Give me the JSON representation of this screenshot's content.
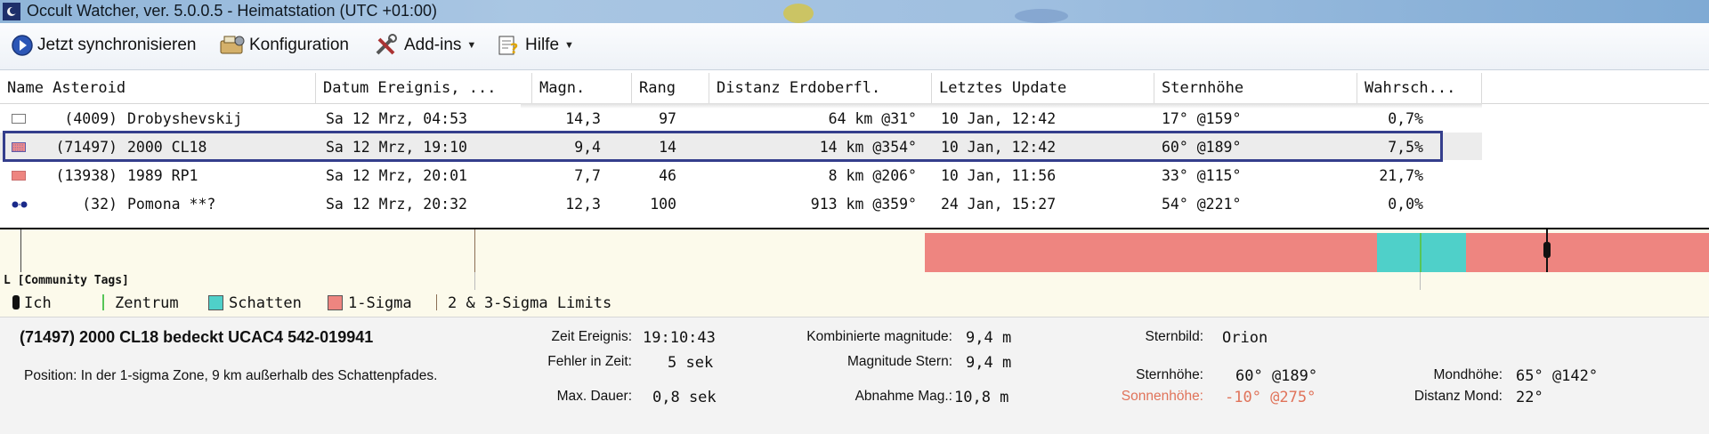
{
  "window": {
    "title": "Occult Watcher, ver. 5.0.0.5 - Heimatstation (UTC +01:00)"
  },
  "toolbar": {
    "sync_label": "Jetzt synchronisieren",
    "config_label": "Konfiguration",
    "addins_label": "Add-ins",
    "help_label": "Hilfe"
  },
  "table": {
    "headers": [
      "Name Asteroid",
      "Datum Ereignis, ...",
      "Magn.",
      "Rang",
      "Distanz Erdoberfl.",
      "Letztes Update",
      "Sternhöhe",
      "Wahrsch..."
    ],
    "rows": [
      {
        "number": "(4009)",
        "name": "Drobyshevskij",
        "date": "Sa 12 Mrz, 04:53",
        "magn": "14,3",
        "rank": "97",
        "distance": "64 km @31°",
        "updated": "10 Jan, 12:42",
        "alt": "17° @159°",
        "prob": "0,7%"
      },
      {
        "number": "(71497)",
        "name": "2000 CL18",
        "date": "Sa 12 Mrz, 19:10",
        "magn": "9,4",
        "rank": "14",
        "distance": "14 km @354°",
        "updated": "10 Jan, 12:42",
        "alt": "60° @189°",
        "prob": "7,5%"
      },
      {
        "number": "(13938)",
        "name": "1989 RP1",
        "date": "Sa 12 Mrz, 20:01",
        "magn": "7,7",
        "rank": "46",
        "distance": "8 km @206°",
        "updated": "10 Jan, 11:56",
        "alt": "33° @115°",
        "prob": "21,7%"
      },
      {
        "number": "(32)",
        "name": "Pomona **?",
        "date": "Sa 12 Mrz, 20:32",
        "magn": "12,3",
        "rank": "100",
        "distance": "913 km @359°",
        "updated": "24 Jan, 15:27",
        "alt": "54° @221°",
        "prob": "0,0%"
      }
    ]
  },
  "timeline": {
    "community_tags_label": "L [Community Tags]",
    "colors": {
      "one_sigma": "#ee8580",
      "shadow": "#4fd0c9",
      "center": "#57c557",
      "background": "#fcfaeb"
    }
  },
  "legend": {
    "me": "Ich",
    "center": "Zentrum",
    "shadow": "Schatten",
    "one_sigma": "1-Sigma",
    "limits": "2 & 3-Sigma Limits"
  },
  "details": {
    "event_title": "(71497) 2000 CL18 bedeckt UCAC4 542-019941",
    "position": "Position:  In der 1-sigma Zone, 9 km außerhalb des Schattenpfades.",
    "event_time_label": "Zeit Ereignis:",
    "event_time": "19:10:43",
    "time_error_label": "Fehler in Zeit:",
    "time_error": "5 sek",
    "max_duration_label": "Max. Dauer:",
    "max_duration": "0,8 sek",
    "combined_mag_label": "Kombinierte magnitude:",
    "combined_mag": "9,4 m",
    "star_mag_label": "Magnitude Stern:",
    "star_mag": "9,4 m",
    "mag_drop_label": "Abnahme Mag.:",
    "mag_drop": "10,8 m",
    "constellation_label": "Sternbild:",
    "constellation": "Orion",
    "star_alt_label": "Sternhöhe:",
    "star_alt": "60° @189°",
    "sun_alt_label": "Sonnenhöhe:",
    "sun_alt": "-10° @275°",
    "moon_alt_label": "Mondhöhe:",
    "moon_alt": "65° @142°",
    "moon_dist_label": "Distanz Mond:",
    "moon_dist": "22°"
  }
}
